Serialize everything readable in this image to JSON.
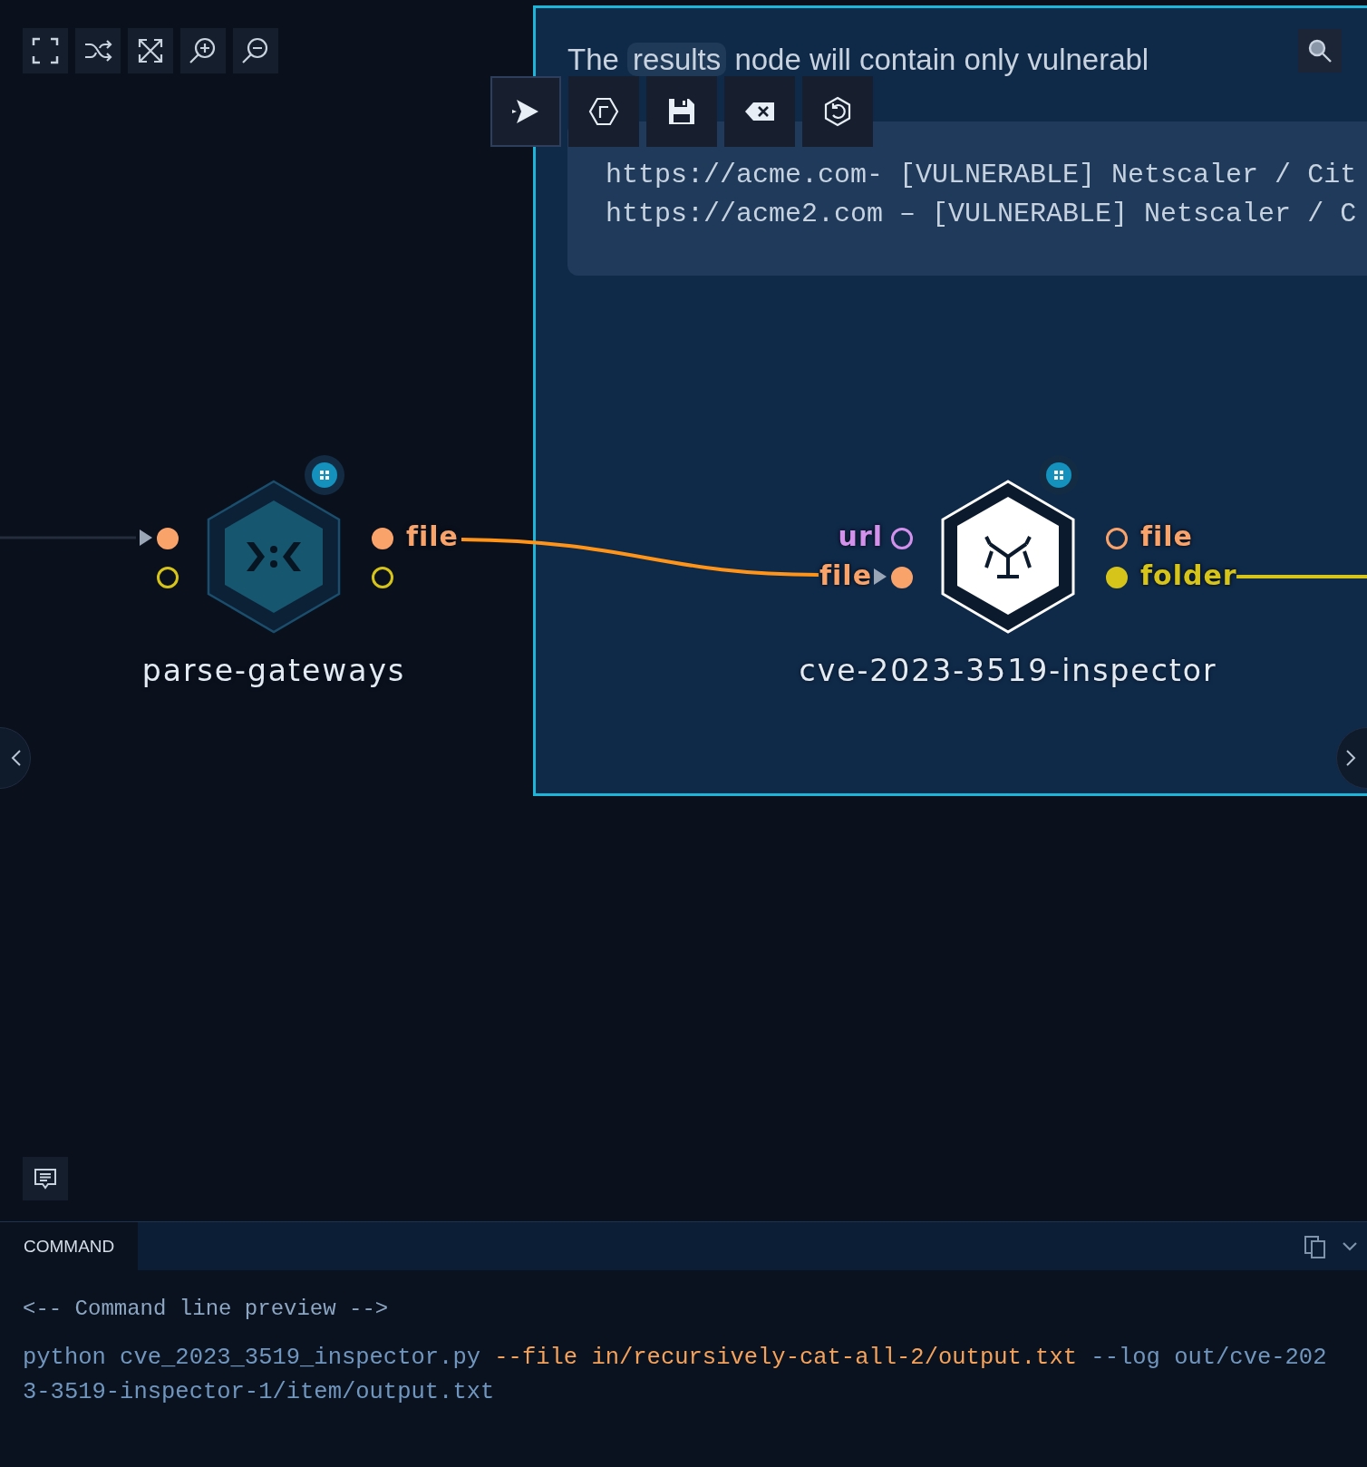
{
  "group": {
    "selected": true,
    "note": {
      "lead": "The",
      "chip": "results",
      "rest": "node will contain only vulnerabl"
    },
    "code_lines": [
      "https://acme.com- [VULNERABLE] Netscaler / Cit",
      "https://acme2.com – [VULNERABLE] Netscaler / C"
    ]
  },
  "nodes": [
    {
      "label": "parse-gateways",
      "kind": "parser",
      "inputs": [
        {
          "color": "#f9a36a",
          "connected": true
        },
        {
          "color": "#d6c41a",
          "connected": false
        }
      ],
      "outputs": [
        {
          "label": "file",
          "color": "#f9a36a",
          "connected": true
        },
        {
          "color": "#d6c41a",
          "connected": false
        }
      ]
    },
    {
      "label": "cve-2023-3519-inspector",
      "kind": "inspector",
      "inputs": [
        {
          "label": "url",
          "color": "#d391ec",
          "connected": false
        },
        {
          "label": "file",
          "color": "#f9a36a",
          "connected": true
        }
      ],
      "outputs": [
        {
          "label": "file",
          "color": "#f9a36a",
          "connected": false
        },
        {
          "label": "folder",
          "color": "#d6c41a",
          "connected": true
        }
      ]
    }
  ],
  "bottom_panel": {
    "tabs": [
      {
        "label": "COMMAND",
        "selected": true
      }
    ],
    "comment": "<-- Command line preview -->",
    "command": [
      {
        "text": "python cve_2023_3519_inspector.py",
        "kind": "plain"
      },
      {
        "text": "--file in/recursively-cat-all-2/output.txt",
        "kind": "input"
      },
      {
        "text": "--log out/cve-2023-3519-inspector-1/item/output.txt",
        "kind": "plain"
      }
    ]
  }
}
